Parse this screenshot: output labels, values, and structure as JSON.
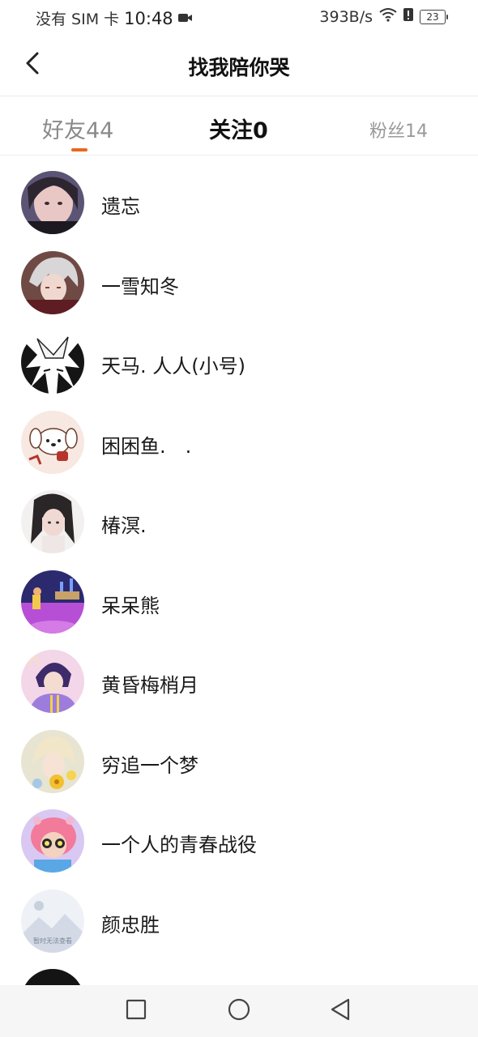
{
  "status_bar": {
    "carrier": "没有 SIM 卡",
    "time": "10:48",
    "network_speed": "393B/s",
    "battery": "23"
  },
  "header": {
    "title": "找我陪你哭"
  },
  "tabs": [
    {
      "label": "好友44",
      "active": false
    },
    {
      "label": "关注0",
      "active": true
    },
    {
      "label": "粉丝14",
      "active": false
    }
  ],
  "accent_color": "#e46a1f",
  "list": {
    "items": [
      {
        "name": "遗忘",
        "avatar": "photo-avatar-girl"
      },
      {
        "name": "一雪知冬",
        "avatar": "anime-avatar-silver-hair"
      },
      {
        "name": "天马. 人人(小号)",
        "avatar": "manga-avatar-white-hair"
      },
      {
        "name": "困困鱼.　.",
        "avatar": "cartoon-dog-avatar"
      },
      {
        "name": "椿溟.",
        "avatar": "photo-avatar-girl"
      },
      {
        "name": "呆呆熊",
        "avatar": "illustration-avatar-purple"
      },
      {
        "name": "黄昏梅梢月",
        "avatar": "anime-avatar-purple-hair"
      },
      {
        "name": "穷追一个梦",
        "avatar": "anime-avatar-flowers"
      },
      {
        "name": "一个人的青春战役",
        "avatar": "cartoon-avatar-pink-hair"
      },
      {
        "name": "颜忠胜",
        "avatar": "placeholder-landscape-avatar",
        "avatar_text": "暂时无法查看"
      }
    ]
  }
}
